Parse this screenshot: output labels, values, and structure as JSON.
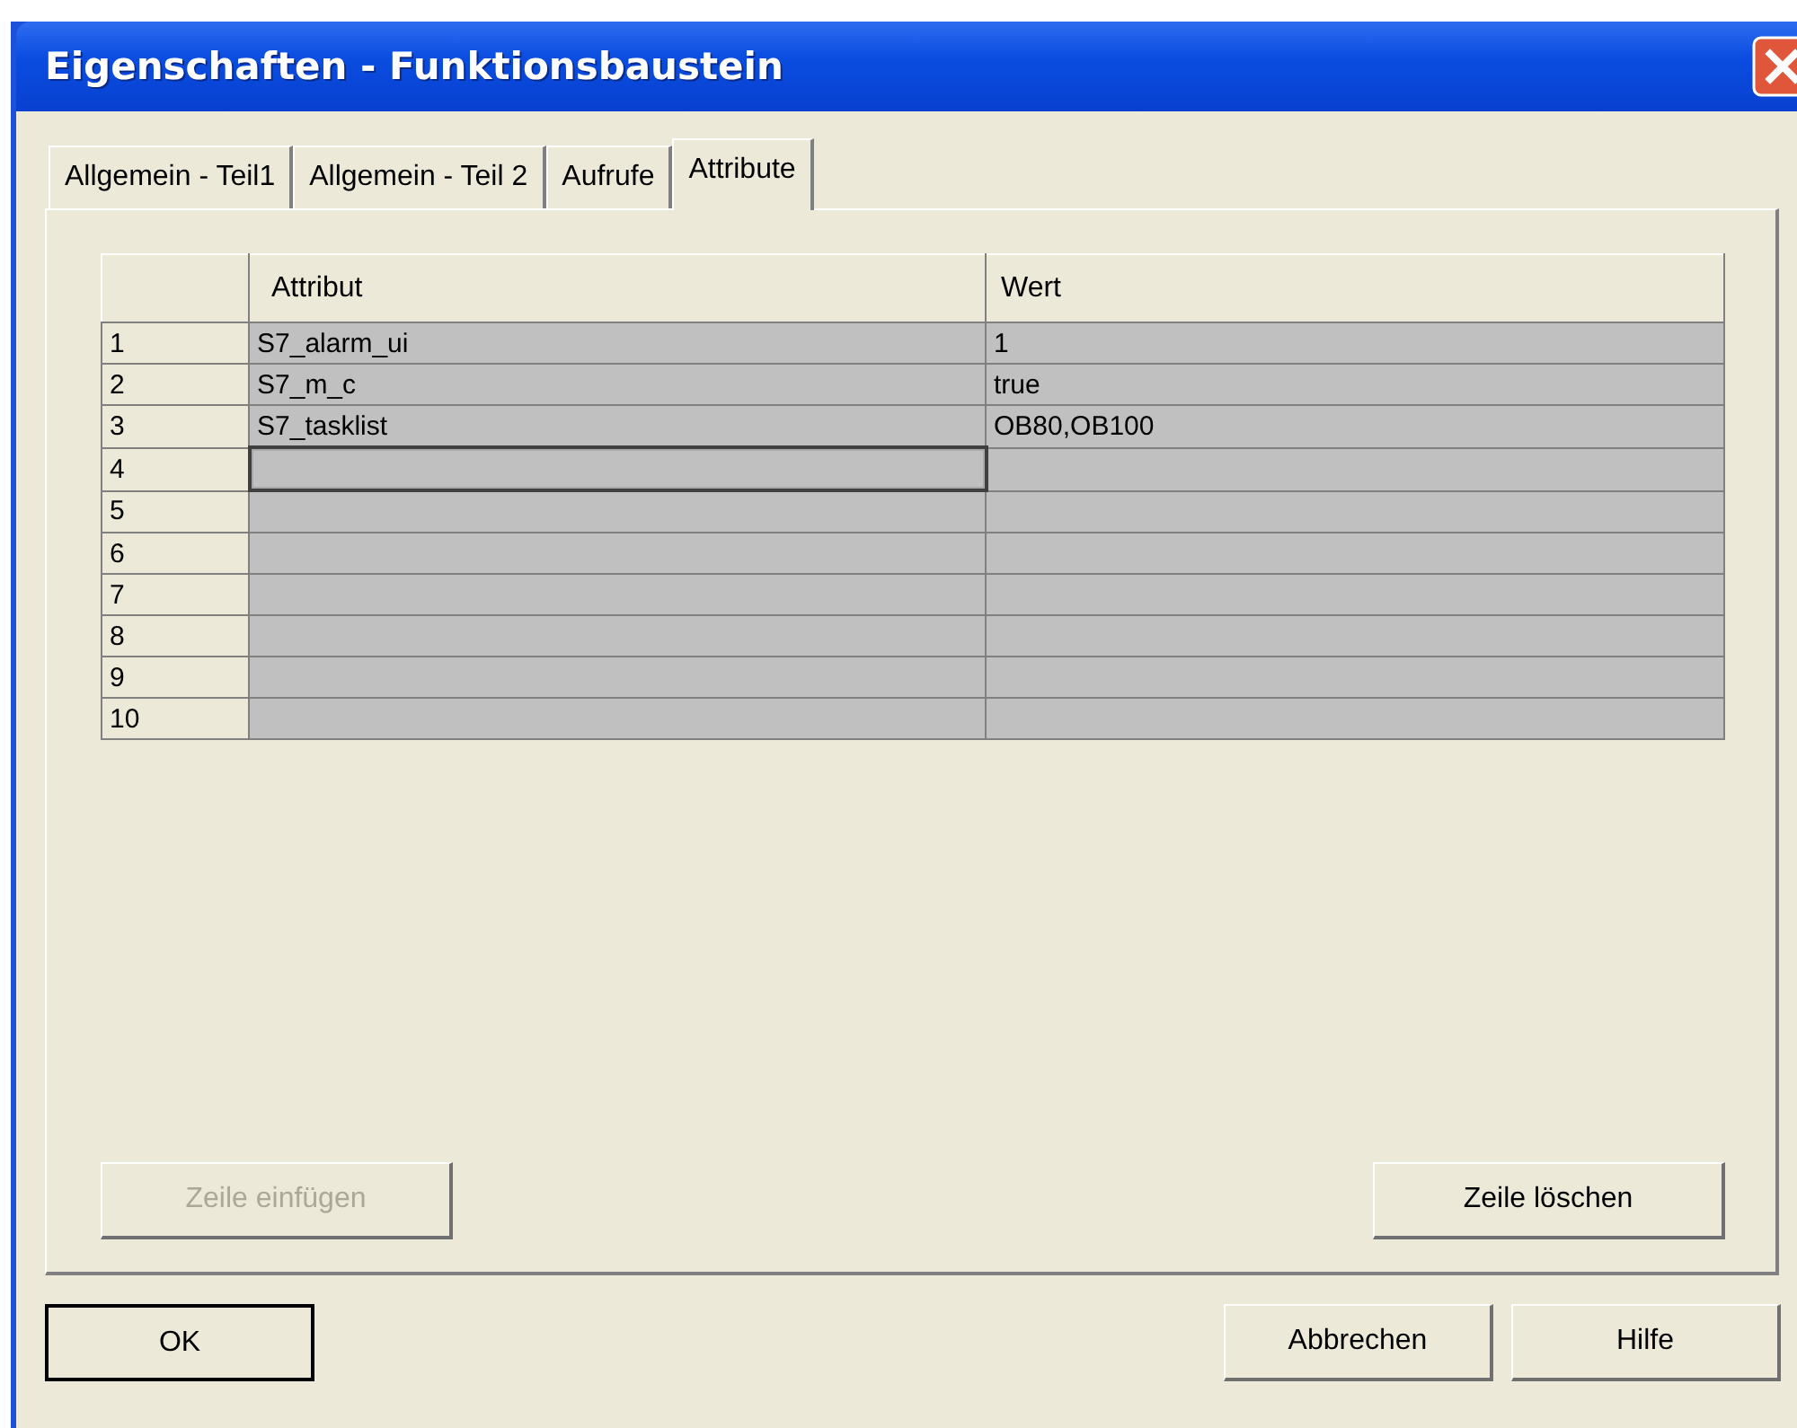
{
  "window": {
    "title": "Eigenschaften - Funktionsbaustein"
  },
  "tabs": [
    {
      "label": "Allgemein - Teil1",
      "selected": false
    },
    {
      "label": "Allgemein - Teil 2",
      "selected": false
    },
    {
      "label": "Aufrufe",
      "selected": false
    },
    {
      "label": "Attribute",
      "selected": true
    }
  ],
  "table": {
    "columns": [
      "Attribut",
      "Wert"
    ],
    "rows": [
      {
        "number": "1",
        "attribut": "S7_alarm_ui",
        "wert": "1",
        "focused": false
      },
      {
        "number": "2",
        "attribut": "S7_m_c",
        "wert": "true",
        "focused": false
      },
      {
        "number": "3",
        "attribut": "S7_tasklist",
        "wert": "OB80,OB100",
        "focused": false
      },
      {
        "number": "4",
        "focused": true
      },
      {
        "number": "5",
        "focused": false
      },
      {
        "number": "6",
        "focused": false
      },
      {
        "number": "7",
        "focused": false
      },
      {
        "number": "8",
        "focused": false
      },
      {
        "number": "9",
        "focused": false
      },
      {
        "number": "10",
        "focused": false
      }
    ]
  },
  "panel_buttons": [
    {
      "label": "Zeile einfügen",
      "disabled": true
    },
    {
      "label": "Zeile löschen",
      "disabled": false
    }
  ],
  "dialog_buttons": [
    {
      "label": "OK",
      "default": true
    },
    {
      "label": "Abbrechen",
      "default": false
    },
    {
      "label": "Hilfe",
      "default": false
    }
  ]
}
